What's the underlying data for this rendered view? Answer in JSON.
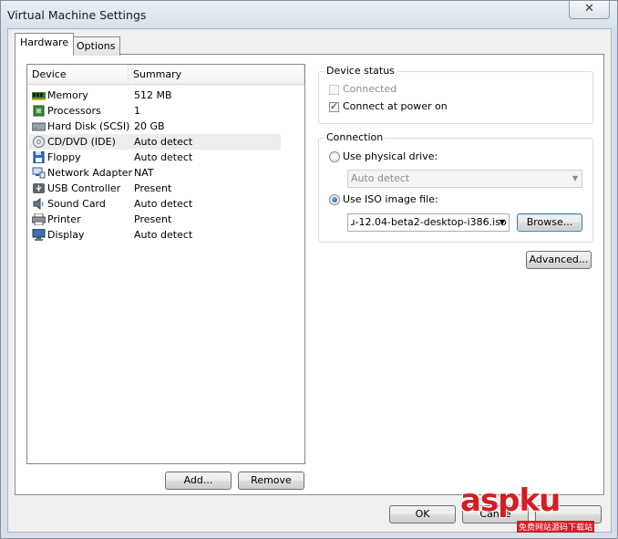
{
  "window": {
    "title": "Virtual Machine Settings",
    "close_glyph": "✕"
  },
  "tabs": [
    {
      "label": "Hardware"
    },
    {
      "label": "Options"
    }
  ],
  "device_list": {
    "columns": [
      "Device",
      "Summary"
    ],
    "rows": [
      {
        "name": "Memory",
        "summary": "512 MB",
        "icon": "memory-icon"
      },
      {
        "name": "Processors",
        "summary": "1",
        "icon": "processor-icon"
      },
      {
        "name": "Hard Disk (SCSI)",
        "summary": "20 GB",
        "icon": "hard-disk-icon"
      },
      {
        "name": "CD/DVD (IDE)",
        "summary": "Auto detect",
        "icon": "cd-dvd-icon"
      },
      {
        "name": "Floppy",
        "summary": "Auto detect",
        "icon": "floppy-icon"
      },
      {
        "name": "Network Adapter",
        "summary": "NAT",
        "icon": "network-adapter-icon"
      },
      {
        "name": "USB Controller",
        "summary": "Present",
        "icon": "usb-icon"
      },
      {
        "name": "Sound Card",
        "summary": "Auto detect",
        "icon": "sound-card-icon"
      },
      {
        "name": "Printer",
        "summary": "Present",
        "icon": "printer-icon"
      },
      {
        "name": "Display",
        "summary": "Auto detect",
        "icon": "display-icon"
      }
    ],
    "selected": "CD/DVD (IDE)"
  },
  "buttons": {
    "add": "Add...",
    "remove": "Remove",
    "browse": "Browse...",
    "advanced": "Advanced...",
    "ok": "OK",
    "cancel": "Cance"
  },
  "device_status": {
    "label": "Device status",
    "connected": {
      "label": "Connected",
      "checked": false,
      "enabled": false
    },
    "connect_at_power_on": {
      "label": "Connect at power on",
      "checked": true
    }
  },
  "connection": {
    "label": "Connection",
    "physical": {
      "label": "Use physical drive:",
      "selected": false
    },
    "physical_drive_value": "Auto detect",
    "iso": {
      "label": "Use ISO image file:",
      "selected": true
    },
    "iso_path": "ɹ-12.04-beta2-desktop-i386.iso"
  },
  "watermark": {
    "text": "aspku",
    "subtext": "免费网站源码下载站"
  }
}
